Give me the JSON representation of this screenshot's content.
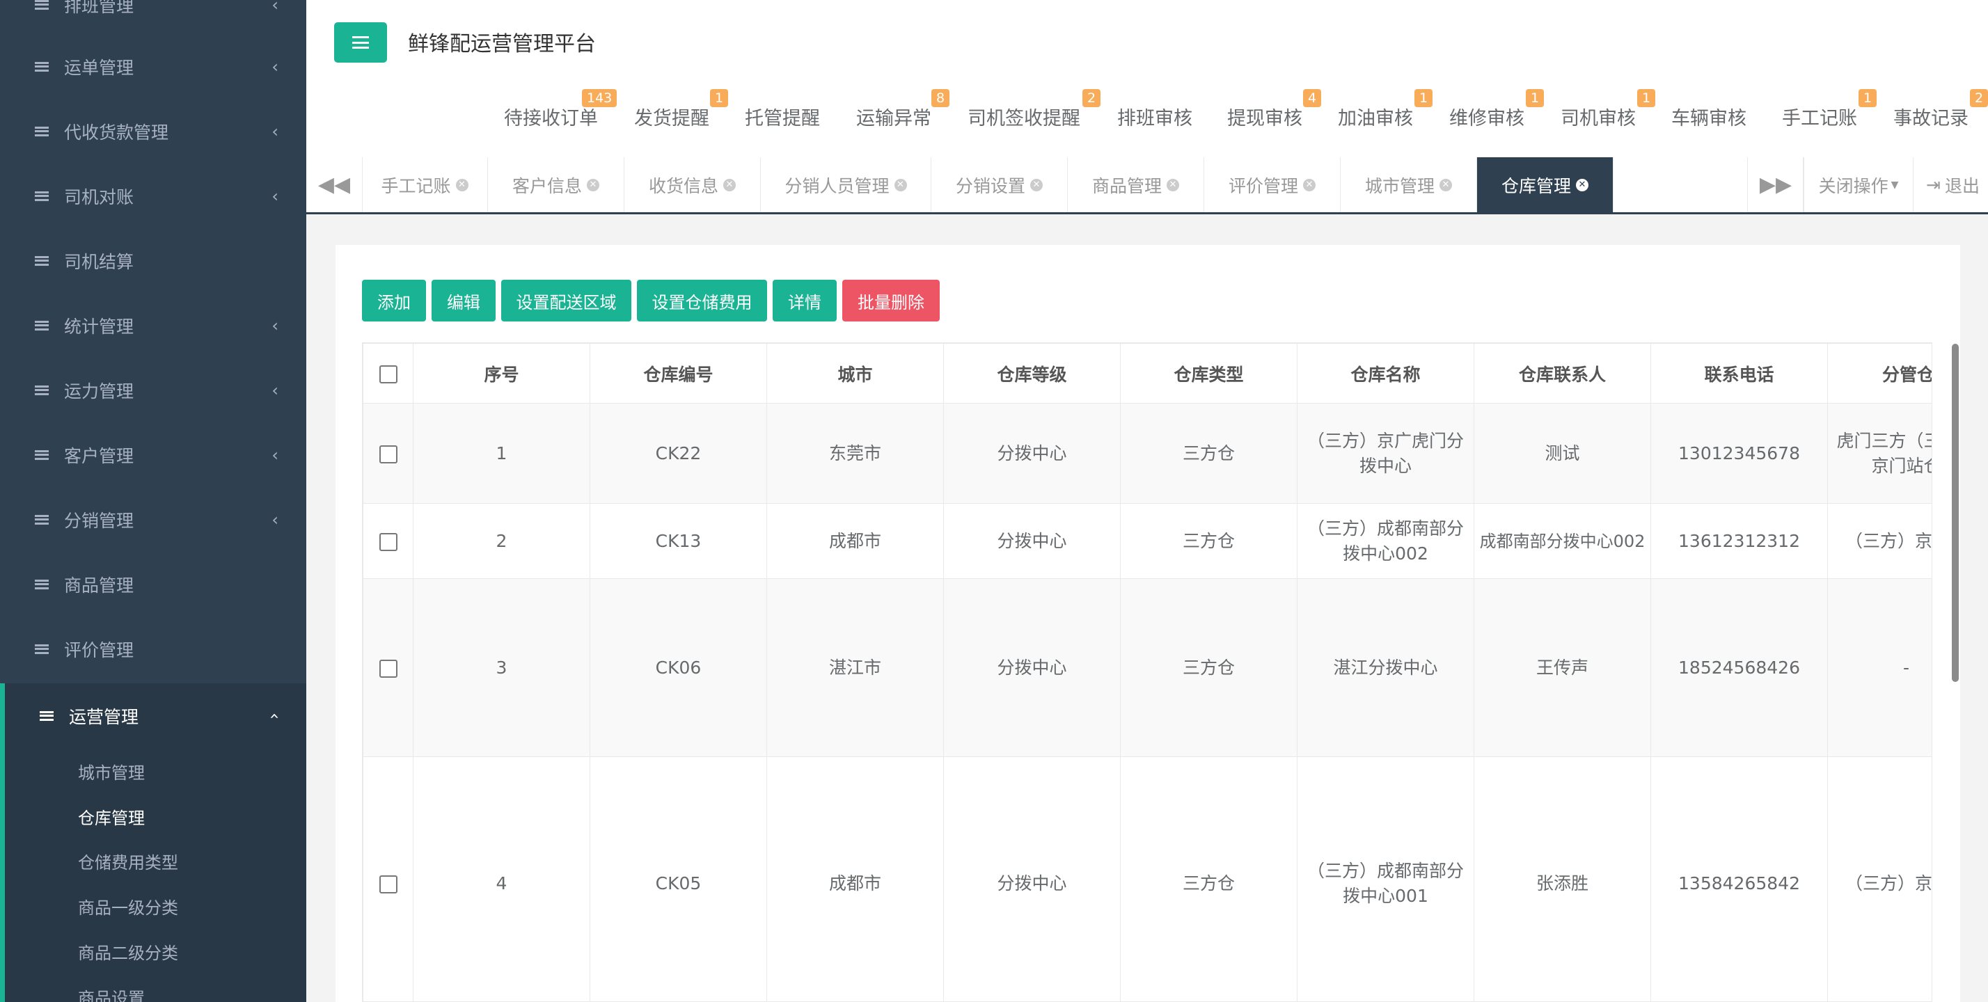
{
  "sidebar": {
    "items": [
      {
        "label": "排班管理",
        "has_children": true
      },
      {
        "label": "运单管理",
        "has_children": true
      },
      {
        "label": "代收货款管理",
        "has_children": true
      },
      {
        "label": "司机对账",
        "has_children": true
      },
      {
        "label": "司机结算",
        "has_children": false
      },
      {
        "label": "统计管理",
        "has_children": true
      },
      {
        "label": "运力管理",
        "has_children": true
      },
      {
        "label": "客户管理",
        "has_children": true
      },
      {
        "label": "分销管理",
        "has_children": true
      },
      {
        "label": "商品管理",
        "has_children": false
      },
      {
        "label": "评价管理",
        "has_children": false
      },
      {
        "label": "运营管理",
        "has_children": true,
        "expanded": true
      }
    ],
    "subitems": [
      {
        "label": "城市管理",
        "selected": false
      },
      {
        "label": "仓库管理",
        "selected": true
      },
      {
        "label": "仓储费用类型",
        "selected": false
      },
      {
        "label": "商品一级分类",
        "selected": false
      },
      {
        "label": "商品二级分类",
        "selected": false
      },
      {
        "label": "商品设置",
        "selected": false
      }
    ]
  },
  "header": {
    "title": "鲜锋配运营管理平台",
    "alerts": [
      {
        "label": "待接收订单",
        "badge": "143"
      },
      {
        "label": "发货提醒",
        "badge": "1"
      },
      {
        "label": "托管提醒",
        "badge": ""
      },
      {
        "label": "运输异常",
        "badge": "8"
      },
      {
        "label": "司机签收提醒",
        "badge": "2"
      },
      {
        "label": "排班审核",
        "badge": ""
      },
      {
        "label": "提现审核",
        "badge": "4"
      },
      {
        "label": "加油审核",
        "badge": "1"
      },
      {
        "label": "维修审核",
        "badge": "1"
      },
      {
        "label": "司机审核",
        "badge": "1"
      },
      {
        "label": "车辆审核",
        "badge": ""
      },
      {
        "label": "手工记账",
        "badge": "1"
      },
      {
        "label": "事故记录",
        "badge": "2"
      }
    ]
  },
  "tabs": {
    "items": [
      {
        "label": "手工记账",
        "active": false
      },
      {
        "label": "客户信息",
        "active": false
      },
      {
        "label": "收货信息",
        "active": false
      },
      {
        "label": "分销人员管理",
        "active": false
      },
      {
        "label": "分销设置",
        "active": false
      },
      {
        "label": "商品管理",
        "active": false
      },
      {
        "label": "评价管理",
        "active": false
      },
      {
        "label": "城市管理",
        "active": false
      },
      {
        "label": "仓库管理",
        "active": true
      }
    ],
    "close_ops": "关闭操作",
    "logout": "退出"
  },
  "toolbar": {
    "add": "添加",
    "edit": "编辑",
    "set_area": "设置配送区域",
    "set_fee": "设置仓储费用",
    "detail": "详情",
    "batch_delete": "批量删除"
  },
  "table": {
    "columns": [
      "序号",
      "仓库编号",
      "城市",
      "仓库等级",
      "仓库类型",
      "仓库名称",
      "仓库联系人",
      "联系电话",
      "分管仓"
    ],
    "rows": [
      [
        "1",
        "CK22",
        "东莞市",
        "分拨中心",
        "三方仓",
        "（三方）京广虎门分拨中心",
        "测试",
        "13012345678",
        "虎门三方（三方）京门站仓"
      ],
      [
        "2",
        "CK13",
        "成都市",
        "分拨中心",
        "三方仓",
        "（三方）成都南部分拨中心002",
        "成都南部分拨中心002",
        "13612312312",
        "（三方）京站仓"
      ],
      [
        "3",
        "CK06",
        "湛江市",
        "分拨中心",
        "三方仓",
        "湛江分拨中心",
        "王传声",
        "18524568426",
        "-"
      ],
      [
        "4",
        "CK05",
        "成都市",
        "分拨中心",
        "三方仓",
        "（三方）成都南部分拨中心001",
        "张添胜",
        "13584265842",
        "（三方）京站仓"
      ]
    ]
  },
  "colors": {
    "primary": "#1ab394",
    "danger": "#ed5565",
    "badge": "#f8ac59",
    "sidebar": "#2f4050"
  }
}
